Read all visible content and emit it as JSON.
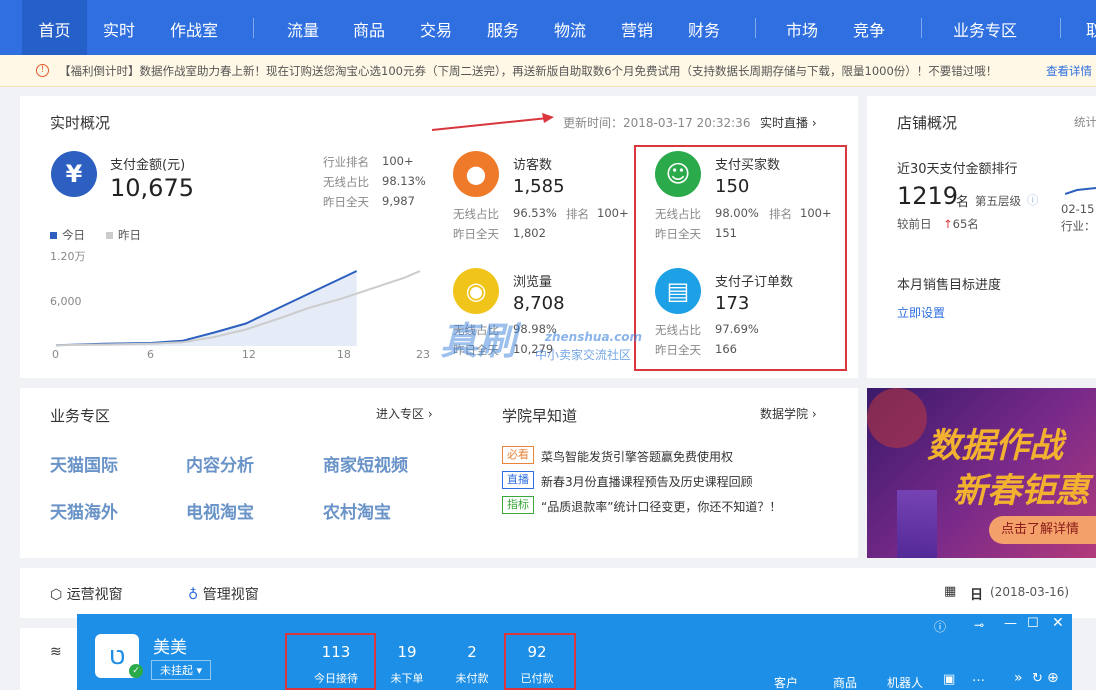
{
  "nav": {
    "items": [
      "首页",
      "实时",
      "作战室",
      "流量",
      "商品",
      "交易",
      "服务",
      "物流",
      "营销",
      "财务",
      "市场",
      "竞争",
      "业务专区",
      "取"
    ]
  },
  "notice": {
    "text": "【福利倒计时】数据作战室助力春上新！现在订购送您淘宝心选100元券（下周二送完），再送新版自助取数6个月免费试用（支持数据长周期存储与下载，限量1000份）！不要错过哦！",
    "link": "查看详情"
  },
  "realtime": {
    "title": "实时概况",
    "update_time": "更新时间：2018-03-17 20:32:36",
    "live_link": "实时直播",
    "pay": {
      "label": "支付金额(元)",
      "value": "10,675",
      "rank_label": "行业排名",
      "rank": "100+",
      "wireless_label": "无线占比",
      "wireless": "98.13%",
      "yesterday_label": "昨日全天",
      "yesterday": "9,987"
    },
    "visitors": {
      "label": "访客数",
      "value": "1,585",
      "wireless_label": "无线占比",
      "wireless": "96.53%",
      "rank_label": "排名",
      "rank": "100+",
      "yesterday_label": "昨日全天",
      "yesterday": "1,802"
    },
    "views": {
      "label": "浏览量",
      "value": "8,708",
      "wireless_label": "无线占比",
      "wireless": "98.98%",
      "yesterday_label": "昨日全天",
      "yesterday": "10,279"
    },
    "buyers": {
      "label": "支付买家数",
      "value": "150",
      "wireless_label": "无线占比",
      "wireless": "98.00%",
      "rank_label": "排名",
      "rank": "100+",
      "yesterday_label": "昨日全天",
      "yesterday": "151"
    },
    "orders": {
      "label": "支付子订单数",
      "value": "173",
      "wireless_label": "无线占比",
      "wireless": "97.69%",
      "yesterday_label": "昨日全天",
      "yesterday": "166"
    },
    "legend_today": "今日",
    "legend_yesterday": "昨日",
    "colors": {
      "today": "#2c5fbf",
      "yesterday": "#cccccc"
    }
  },
  "chart_data": {
    "type": "line",
    "x_ticks": [
      "0",
      "6",
      "12",
      "18",
      "23"
    ],
    "y_ticks": [
      "1.20万",
      "6,000"
    ],
    "ylim": [
      0,
      12000
    ],
    "series": [
      {
        "name": "今日",
        "x": [
          0,
          3,
          6,
          8,
          10,
          12,
          14,
          16,
          18,
          19
        ],
        "values": [
          100,
          300,
          400,
          700,
          1800,
          3000,
          5000,
          7000,
          9000,
          10000
        ]
      },
      {
        "name": "昨日",
        "x": [
          0,
          3,
          6,
          8,
          10,
          12,
          14,
          16,
          18,
          20,
          22,
          23
        ],
        "values": [
          100,
          200,
          300,
          500,
          1200,
          2200,
          3600,
          5100,
          6300,
          7700,
          9100,
          9987
        ]
      }
    ]
  },
  "shop": {
    "title": "店铺概况",
    "stats_link": "统计",
    "rank_label": "近30天支付金额排行",
    "rank_value": "1219",
    "rank_unit": "名",
    "tier": "第五层级",
    "compare_label": "较前日",
    "compare_value": "65名",
    "date": "02-15",
    "industry": "行业：",
    "target_label": "本月销售目标进度",
    "target_link": "立即设置"
  },
  "business": {
    "title": "业务专区",
    "enter": "进入专区",
    "items": [
      "天猫国际",
      "内容分析",
      "商家短视频",
      "天猫海外",
      "电视淘宝",
      "农村淘宝"
    ]
  },
  "academy": {
    "title": "学院早知道",
    "link": "数据学院",
    "items": [
      {
        "tag": "必看",
        "color": "#e8853a",
        "text": "菜鸟智能发货引擎答题赢免费使用权"
      },
      {
        "tag": "直播",
        "color": "#2f6fe0",
        "text": "新春3月份直播课程预告及历史课程回顾"
      },
      {
        "tag": "指标",
        "color": "#3aa83a",
        "text": "“品质退款率”统计口径变更，你还不知道？！"
      }
    ]
  },
  "banner": {
    "line1": "数据作战",
    "line2": "新春钜惠",
    "button": "点击了解详情"
  },
  "view_bar": {
    "ops": "运营视窗",
    "mgmt": "管理视窗",
    "day": "日",
    "date": "(2018-03-16)"
  },
  "watermark": {
    "brand": "真刷",
    "url": "zhenshua.com",
    "tagline": "中小卖家交流社区"
  },
  "chat": {
    "name": "美美",
    "status": "未挂起",
    "counters": [
      {
        "value": "113",
        "label": "今日接待"
      },
      {
        "value": "19",
        "label": "未下单"
      },
      {
        "value": "2",
        "label": "未付款"
      },
      {
        "value": "92",
        "label": "已付款"
      }
    ],
    "tabs": [
      "客户",
      "商品",
      "机器人"
    ]
  }
}
